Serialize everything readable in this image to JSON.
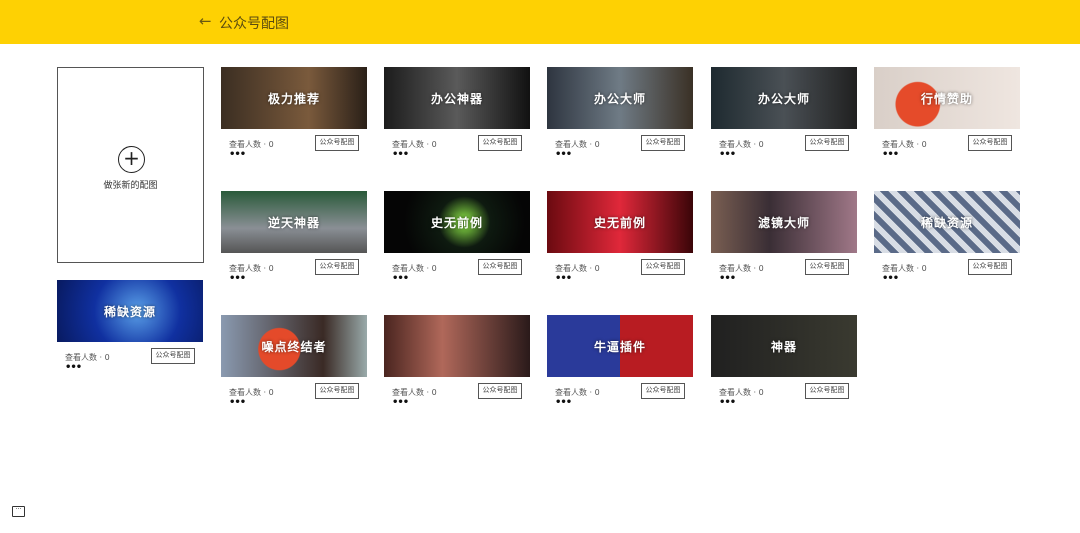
{
  "header": {
    "back_icon": "arrow-left-icon",
    "title": "公众号配图"
  },
  "new_card": {
    "icon": "plus-circle-icon",
    "label": "做张新的配图"
  },
  "card_views": "查看人数 · 0",
  "card_tag": "公众号配图",
  "more": "•••",
  "cards": [
    {
      "title": "极力推荐",
      "bg": "linear-gradient(90deg,#3b2e22,#7a5a3c 60%,#2a2018)"
    },
    {
      "title": "办公神器",
      "bg": "linear-gradient(90deg,#1c1c1c,#5a5a5a 50%,#111)"
    },
    {
      "title": "办公大师",
      "bg": "linear-gradient(90deg,#2e3540,#6f7b85 50%,#3a3025)"
    },
    {
      "title": "办公大师",
      "bg": "linear-gradient(90deg,#1e2a30,#4a5055 50%,#202020)"
    },
    {
      "title": "行情赞助",
      "bg": "radial-gradient(circle at 30% 60%,#e54b2a 20%,transparent 21%),linear-gradient(90deg,#d9cfc8,#efe6e0)"
    },
    {
      "title": "逆天神器",
      "bg": "linear-gradient(180deg,#2a5a3a,#8a8f95 60%,#555)"
    },
    {
      "title": "史无前例",
      "bg": "radial-gradient(circle at 55% 50%,#6fb63a 8%,#0e1a10 30%,#050505 70%)"
    },
    {
      "title": "史无前例",
      "bg": "linear-gradient(90deg,#6b0a10,#e0283a 50%,#3a0508)"
    },
    {
      "title": "滤镜大师",
      "bg": "linear-gradient(90deg,#7a5f52,#3a2e35 40%,#a07888)"
    },
    {
      "title": "稀缺资源",
      "bg": "repeating-linear-gradient(45deg,#5a6a88 0 6px,#d8dde5 6px 12px)"
    },
    {
      "title": "噪点终结者",
      "bg": "radial-gradient(circle at 40% 55%,#e44a2a 22%,transparent 23%),linear-gradient(90deg,#8a9ab0,#3a2a25 70%,#9aa)"
    },
    {
      "title": "",
      "bg": "linear-gradient(90deg,#4a2520,#b0685a 40%,#2a1a1a)"
    },
    {
      "title": "牛逼插件",
      "bg": "linear-gradient(90deg,#2a3a9a 50%,#b81c22 50%)"
    },
    {
      "title": "神器",
      "bg": "linear-gradient(90deg,#202020,#3a3a30)"
    }
  ],
  "left_card": {
    "title": "稀缺资源",
    "bg": "radial-gradient(circle at 55% 50%,#5aa0e8,#1030a0 50%,#081a60)"
  },
  "feedback_icon": "chat-feedback-icon"
}
